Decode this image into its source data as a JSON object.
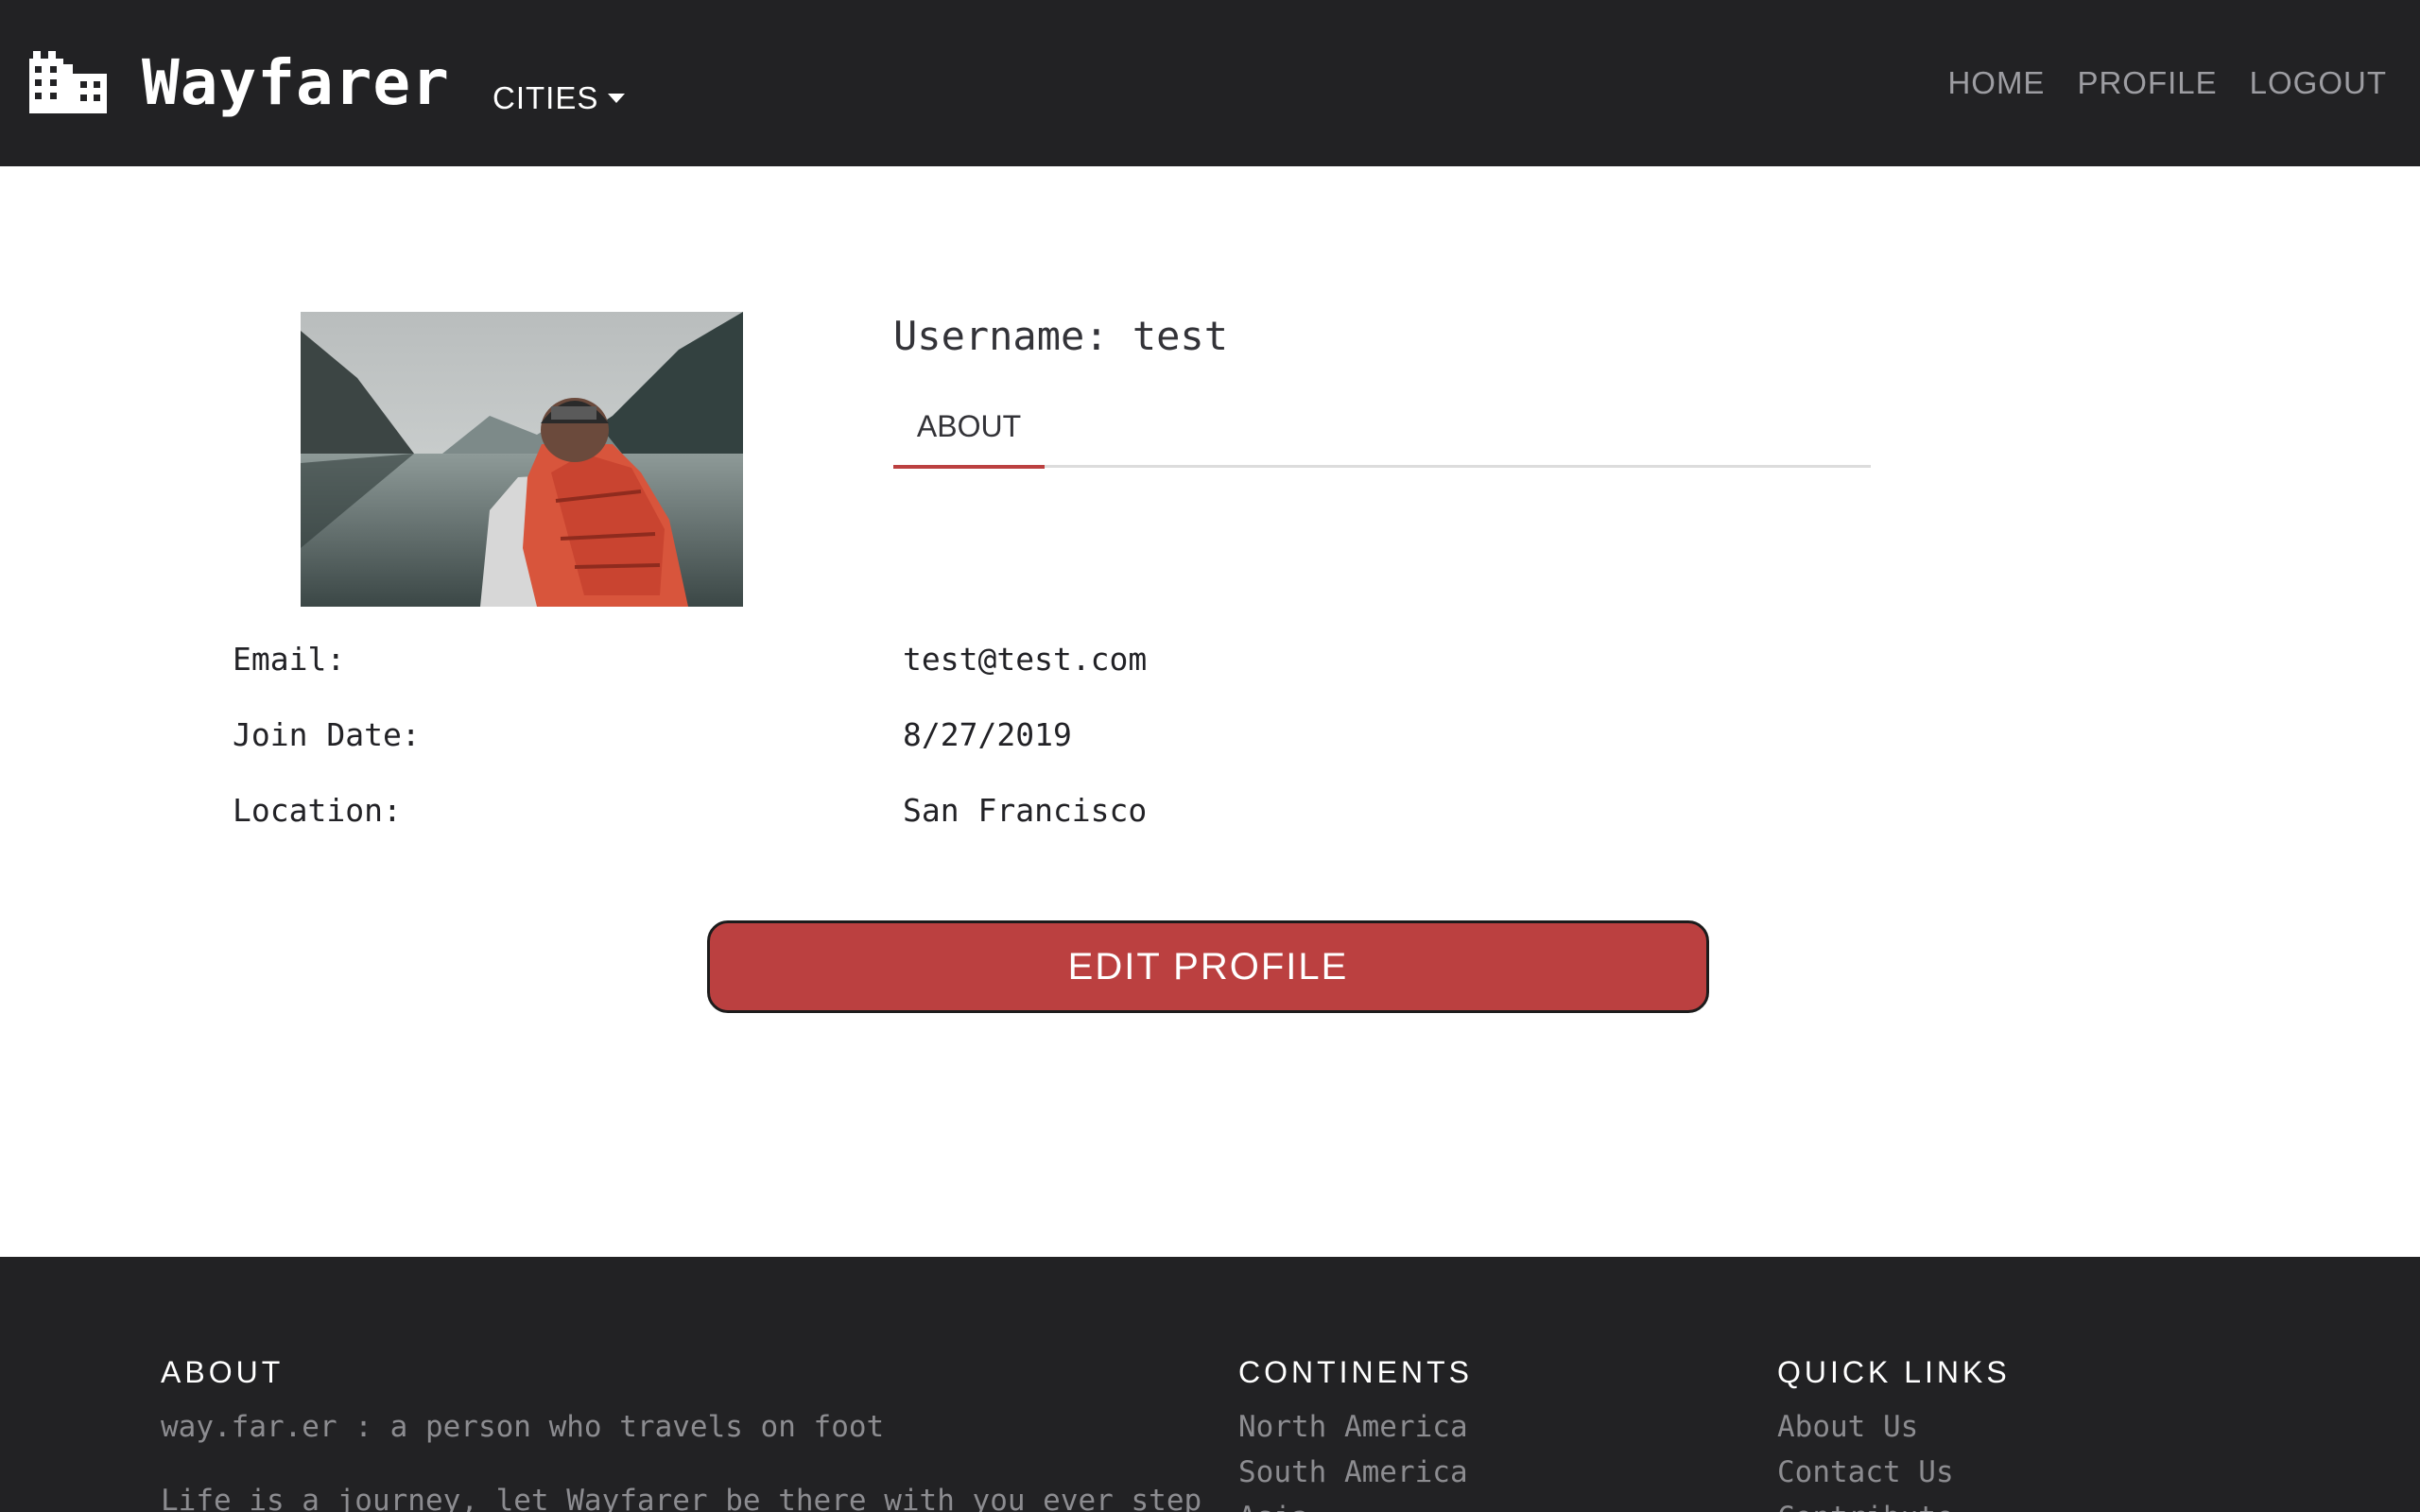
{
  "navbar": {
    "brand": "Wayfarer",
    "cities_label": "CITIES",
    "links": [
      "HOME",
      "PROFILE",
      "LOGOUT"
    ]
  },
  "profile": {
    "username_label": "Username: test",
    "tab_about": "ABOUT",
    "fields": [
      {
        "label": "Email:",
        "value": "test@test.com"
      },
      {
        "label": "Join Date:",
        "value": "8/27/2019"
      },
      {
        "label": "Location:",
        "value": "San Francisco"
      }
    ],
    "edit_button": "EDIT PROFILE"
  },
  "footer": {
    "about": {
      "heading": "ABOUT",
      "tagline": "way.far.er : a person who travels on foot",
      "body": "Life is a journey, let Wayfarer be there with you ever step"
    },
    "continents": {
      "heading": "CONTINENTS",
      "items": [
        "North America",
        "South America",
        "Asia"
      ]
    },
    "quick_links": {
      "heading": "QUICK LINKS",
      "items": [
        "About Us",
        "Contact Us",
        "Contribute"
      ]
    }
  },
  "colors": {
    "nav_bg": "#222224",
    "accent": "#bb4040",
    "muted_text": "#8c8c90"
  },
  "icons": [
    "city-icon",
    "caret-down-icon"
  ]
}
